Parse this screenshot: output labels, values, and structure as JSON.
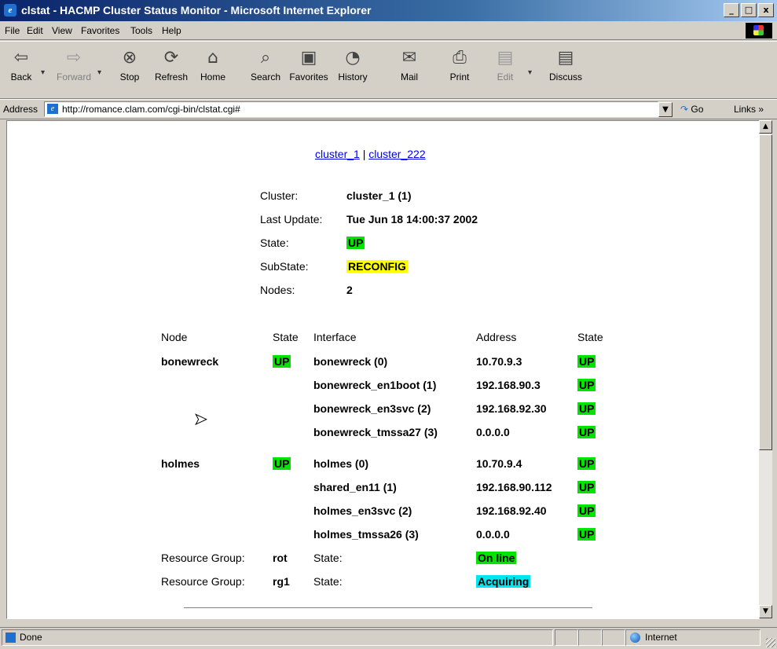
{
  "window": {
    "title": "clstat - HACMP Cluster Status Monitor - Microsoft Internet Explorer",
    "buttons": [
      "_",
      "□",
      "x"
    ]
  },
  "menu": [
    "File",
    "Edit",
    "View",
    "Favorites",
    "Tools",
    "Help"
  ],
  "toolbar": {
    "back": "Back",
    "forward": "Forward",
    "stop": "Stop",
    "refresh": "Refresh",
    "home": "Home",
    "search": "Search",
    "favorites": "Favorites",
    "history": "History",
    "mail": "Mail",
    "print": "Print",
    "edit": "Edit",
    "discuss": "Discuss"
  },
  "address": {
    "label": "Address",
    "url": "http://romance.clam.com/cgi-bin/clstat.cgi#",
    "go": "Go",
    "links": "Links »"
  },
  "page": {
    "cluster_links": [
      "cluster_1",
      "cluster_222"
    ],
    "link_sep": "|",
    "info": {
      "cluster_label": "Cluster:",
      "cluster_value": "cluster_1 (1)",
      "update_label": "Last Update:",
      "update_value": "Tue Jun 18 14:00:37 2002",
      "state_label": "State:",
      "state_value": "UP",
      "substate_label": "SubState:",
      "substate_value": "RECONFIG",
      "nodes_label": "Nodes:",
      "nodes_value": "2"
    },
    "headers": {
      "node": "Node",
      "state": "State",
      "interface": "Interface",
      "address": "Address",
      "if_state": "State"
    },
    "nodes": [
      {
        "name": "bonewreck",
        "state": "UP",
        "interfaces": [
          {
            "name": "bonewreck (0)",
            "address": "10.70.9.3",
            "state": "UP"
          },
          {
            "name": "bonewreck_en1boot (1)",
            "address": "192.168.90.3",
            "state": "UP"
          },
          {
            "name": "bonewreck_en3svc (2)",
            "address": "192.168.92.30",
            "state": "UP"
          },
          {
            "name": "bonewreck_tmssa27 (3)",
            "address": "0.0.0.0",
            "state": "UP"
          }
        ]
      },
      {
        "name": "holmes",
        "state": "UP",
        "interfaces": [
          {
            "name": "holmes (0)",
            "address": "10.70.9.4",
            "state": "UP"
          },
          {
            "name": "shared_en11 (1)",
            "address": "192.168.90.112",
            "state": "UP"
          },
          {
            "name": "holmes_en3svc (2)",
            "address": "192.168.92.40",
            "state": "UP"
          },
          {
            "name": "holmes_tmssa26 (3)",
            "address": "0.0.0.0",
            "state": "UP"
          }
        ]
      }
    ],
    "resource_groups": [
      {
        "label": "Resource Group:",
        "name": "rot",
        "state_label": "State:",
        "state": "On line"
      },
      {
        "label": "Resource Group:",
        "name": "rg1",
        "state_label": "State:",
        "state": "Acquiring"
      }
    ]
  },
  "status": {
    "text": "Done",
    "zone": "Internet"
  },
  "colors": {
    "up": "#00e400",
    "reconfig": "#ffff00",
    "acquiring": "#00e5ee",
    "titlebar": "#0a246a"
  }
}
